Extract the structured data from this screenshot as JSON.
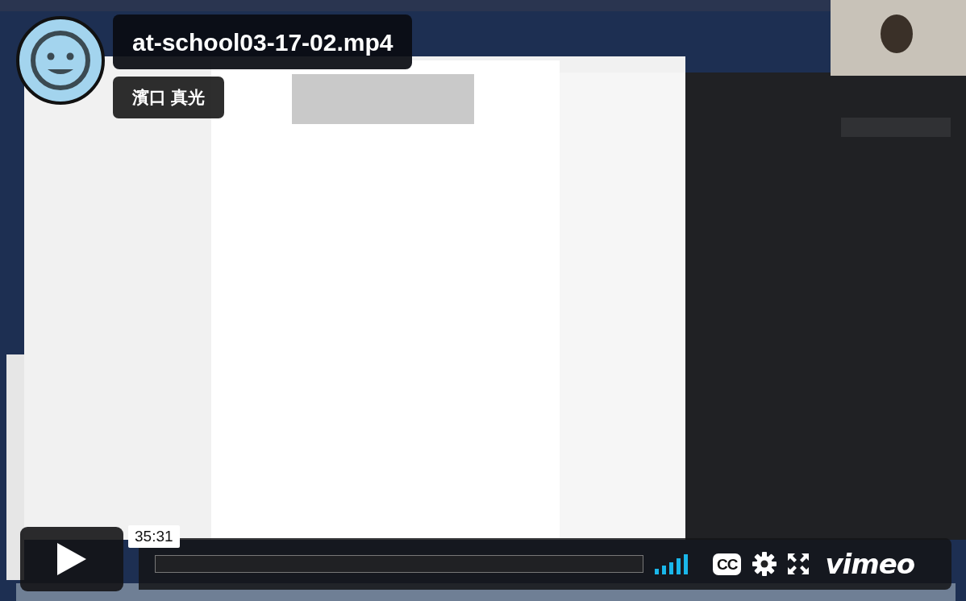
{
  "player": {
    "title": "at-school03-17-02.mp4",
    "author": "濱口 真光"
  },
  "controls": {
    "time": "35:31",
    "progress": {
      "level": 0
    },
    "captions": "CC",
    "logo": "vimeo"
  }
}
